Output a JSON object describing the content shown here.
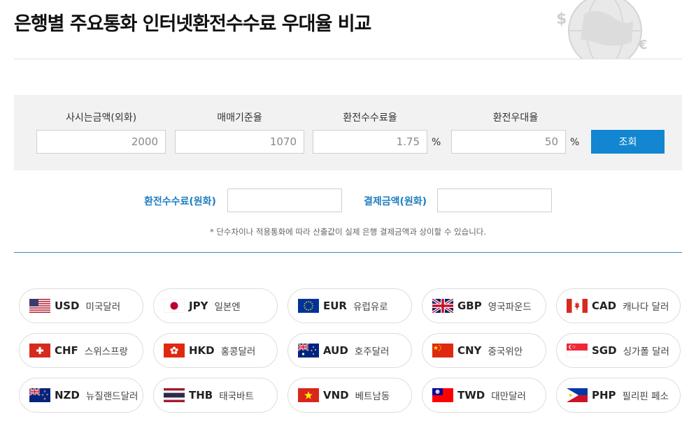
{
  "page": {
    "title": "은행별 주요통화 인터넷환전수수료 우대율 비교"
  },
  "calculator": {
    "cash_amount": {
      "label": "사시는금액(외화)",
      "value": "2000"
    },
    "base_rate": {
      "label": "매매기준율",
      "value": "1070"
    },
    "fee_rate": {
      "label": "환전수수료율",
      "value": "1.75",
      "unit": "%"
    },
    "preferential_rate": {
      "label": "환전우대율",
      "value": "50",
      "unit": "%"
    },
    "lookup_button": "조회"
  },
  "results": {
    "fee_label": "환전수수료(원화)",
    "fee_value": "",
    "payment_label": "결제금액(원화)",
    "payment_value": ""
  },
  "note": "* 단수차이나 적용통화에 따라 산출값이 실제 은행 결제금액과 상이할 수 있습니다.",
  "accent_color": "#1286d0",
  "currencies": [
    {
      "code": "USD",
      "name": "미국달러",
      "flag": "us-flag-icon"
    },
    {
      "code": "JPY",
      "name": "일본엔",
      "flag": "jp-flag-icon"
    },
    {
      "code": "EUR",
      "name": "유럽유로",
      "flag": "eu-flag-icon"
    },
    {
      "code": "GBP",
      "name": "영국파운드",
      "flag": "gb-flag-icon"
    },
    {
      "code": "CAD",
      "name": "캐나다 달러",
      "flag": "ca-flag-icon"
    },
    {
      "code": "CHF",
      "name": "스위스프랑",
      "flag": "ch-flag-icon"
    },
    {
      "code": "HKD",
      "name": "홍콩달러",
      "flag": "hk-flag-icon"
    },
    {
      "code": "AUD",
      "name": "호주달러",
      "flag": "au-flag-icon"
    },
    {
      "code": "CNY",
      "name": "중국위안",
      "flag": "cn-flag-icon"
    },
    {
      "code": "SGD",
      "name": "싱가폴 달러",
      "flag": "sg-flag-icon"
    },
    {
      "code": "NZD",
      "name": "뉴질랜드달러",
      "flag": "nz-flag-icon"
    },
    {
      "code": "THB",
      "name": "태국바트",
      "flag": "th-flag-icon"
    },
    {
      "code": "VND",
      "name": "베트남동",
      "flag": "vn-flag-icon"
    },
    {
      "code": "TWD",
      "name": "대만달러",
      "flag": "tw-flag-icon"
    },
    {
      "code": "PHP",
      "name": "필리핀 페소",
      "flag": "ph-flag-icon"
    }
  ]
}
